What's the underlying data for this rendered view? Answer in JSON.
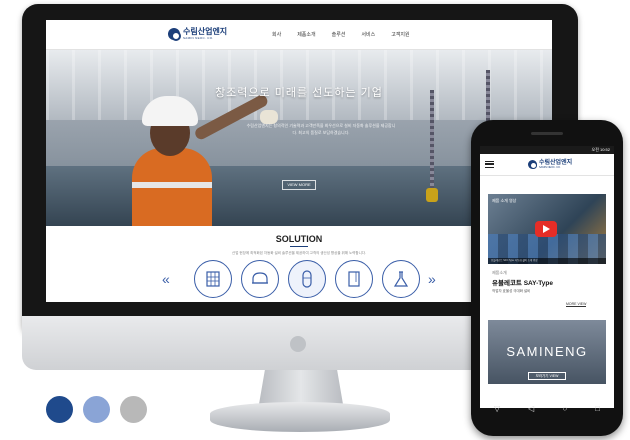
{
  "desktop": {
    "logo": {
      "text": "수림산업엔지",
      "sub": "SAMIN NEOC. CO."
    },
    "nav": [
      "회사",
      "제품소개",
      "솔루션",
      "서비스",
      "고객지원"
    ],
    "hero": {
      "title": "창조력으로 미래를 선도하는 기업",
      "description": "수림산업엔지는 창의적인 기술력과 고객만족을 최우선으로 설비 자동화 솔루션을 제공합니다. 최고의 품질로 보답하겠습니다.",
      "button": "VIEW MORE"
    },
    "solution": {
      "title": "SOLUTION",
      "subtitle": "산업 현장에 최적화된 자동화 설비 솔루션을 제공하여 고객의 생산성 향상을 위해 노력합니다.",
      "prev": "«",
      "next": "»",
      "icons": [
        "grid-icon",
        "hat-icon",
        "tube-icon",
        "document-icon",
        "flask-icon"
      ]
    }
  },
  "phone": {
    "status": "오전 10:52",
    "logo": {
      "text": "수림산업엔지",
      "sub": "SAMIN NEOC. CO."
    },
    "video": {
      "title": "제품 소개 영상",
      "caption": "유블레코트 SAY-Type 자동화 설비 소개 영상"
    },
    "product": {
      "category": "제품소개",
      "title": "유블레코트 SAY-Type",
      "subtitle": "작업자 효율성 극대화 설비",
      "more": "MORE VIEW"
    },
    "banner": {
      "brand": "SAMINENG",
      "button": "보러가기 VIEW"
    },
    "navbar": [
      "▽",
      "◁",
      "○",
      "□"
    ]
  },
  "colors": {
    "brand": "#1c3f7a",
    "accent": "#3a5ea8",
    "dots": [
      "#1f4a8c",
      "#8aa4d6",
      "#b8b8b8"
    ]
  }
}
